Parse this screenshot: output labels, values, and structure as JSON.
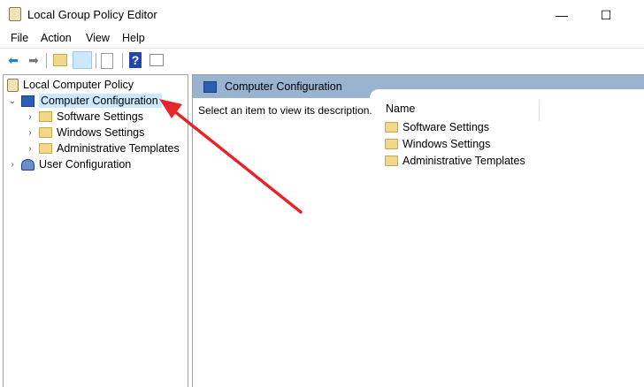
{
  "window": {
    "title": "Local Group Policy Editor",
    "minimize": "—",
    "maximize": "☐"
  },
  "menu": [
    "File",
    "Action",
    "View",
    "Help"
  ],
  "tree": {
    "root": "Local Computer Policy",
    "computer": "Computer Configuration",
    "children": [
      "Software Settings",
      "Windows Settings",
      "Administrative Templates"
    ],
    "user": "User Configuration"
  },
  "pane": {
    "title": "Computer Configuration",
    "description": "Select an item to view its description.",
    "column": "Name",
    "items": [
      "Software Settings",
      "Windows Settings",
      "Administrative Templates"
    ]
  },
  "colors": {
    "header": "#99b4d1",
    "selection": "#cce8ff",
    "arrow": "#e8232a"
  }
}
